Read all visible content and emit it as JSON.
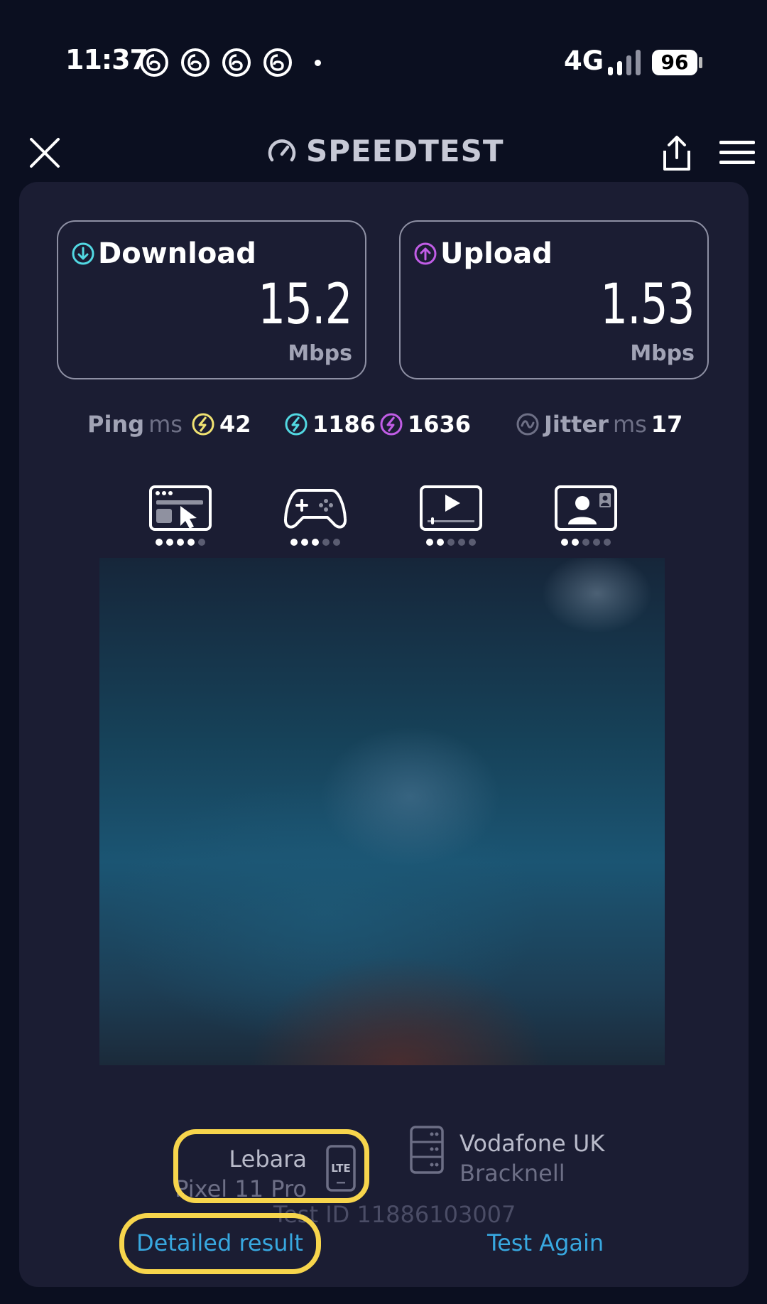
{
  "status_bar": {
    "time": "11:37",
    "network_type": "4G",
    "battery_level": "96",
    "notification_icons": [
      "threads-icon",
      "threads-icon",
      "threads-icon",
      "threads-icon"
    ]
  },
  "app_bar": {
    "title": "SPEEDTEST",
    "close_icon": "close-icon",
    "share_icon": "share-icon",
    "menu_icon": "menu-icon"
  },
  "results": {
    "download": {
      "label": "Download",
      "value": "15.2",
      "unit": "Mbps",
      "icon_color": "#52d8e2"
    },
    "upload": {
      "label": "Upload",
      "value": "1.53",
      "unit": "Mbps",
      "icon_color": "#c15de6"
    }
  },
  "ping": {
    "label": "Ping",
    "unit": "ms",
    "idle": "42",
    "download": "1186",
    "upload": "1636",
    "idle_color": "#f0e272",
    "download_color": "#52d8e2",
    "upload_color": "#c15de6"
  },
  "jitter": {
    "label": "Jitter",
    "unit": "ms",
    "value": "17"
  },
  "use_cases": [
    {
      "icon": "web-browsing-icon",
      "rating": 4,
      "max": 5
    },
    {
      "icon": "gaming-icon",
      "rating": 3,
      "max": 5
    },
    {
      "icon": "video-streaming-icon",
      "rating": 2,
      "max": 5
    },
    {
      "icon": "video-call-icon",
      "rating": 2,
      "max": 5
    }
  ],
  "provider": {
    "name": "Lebara",
    "device": "Pixel 11 Pro",
    "connection_badge": "LTE"
  },
  "server": {
    "name": "Vodafone UK",
    "location": "Bracknell"
  },
  "test_id": "Test ID 11886103007",
  "actions": {
    "detailed": "Detailed result",
    "again": "Test Again"
  },
  "accent_color": "#38a8e0",
  "highlight_color": "#f7d54c"
}
